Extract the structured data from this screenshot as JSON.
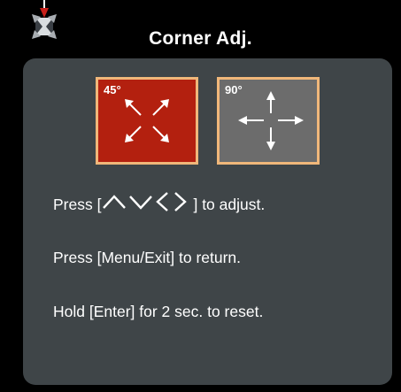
{
  "title": "Corner Adj.",
  "modes": [
    {
      "label": "45°",
      "selected": true,
      "icon": "diagonal-arrows-icon"
    },
    {
      "label": "90°",
      "selected": false,
      "icon": "cross-arrows-icon"
    }
  ],
  "instructions": {
    "adjust_prefix": "Press [",
    "adjust_suffix": "] to adjust.",
    "return": "Press [Menu/Exit] to return.",
    "reset": "Hold [Enter] for 2 sec. to reset."
  },
  "colors": {
    "background": "#000000",
    "panel": "#3f4548",
    "selected_mode": "#b3200f",
    "unselected_mode": "#6c6c6c",
    "mode_border": "#f0b77a",
    "text": "#ffffff"
  },
  "icons": {
    "menu_icon": "corner-adjust-icon",
    "keys": [
      "up-arrow-icon",
      "down-arrow-icon",
      "left-arrow-icon",
      "right-arrow-icon"
    ]
  }
}
